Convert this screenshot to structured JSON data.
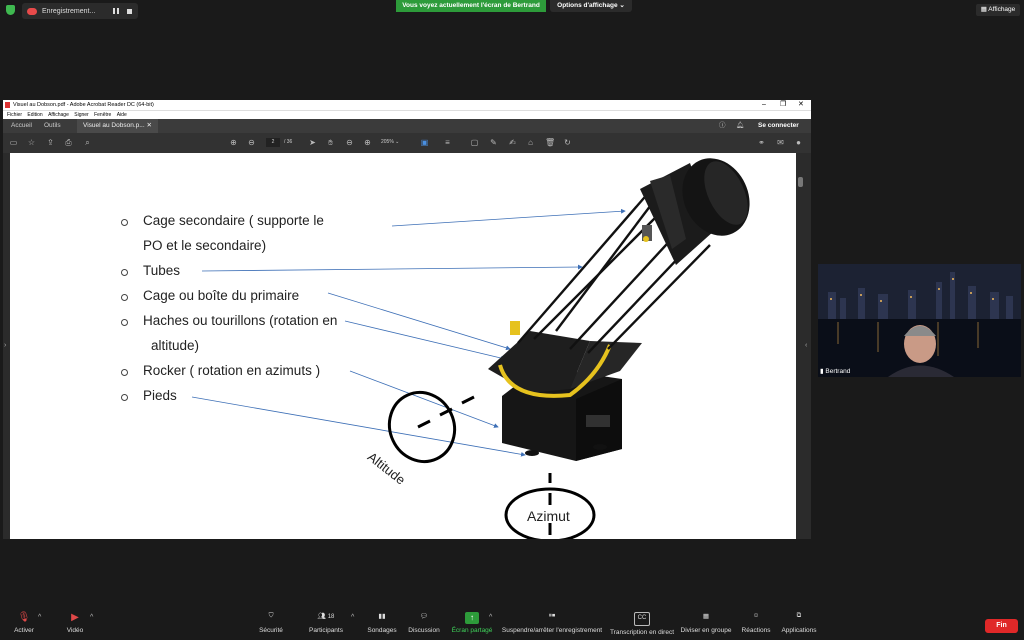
{
  "zoom": {
    "recording_label": "Enregistrement...",
    "share_banner": "Vous voyez actuellement l'écran de Bertrand",
    "view_options": "Options d'affichage",
    "affichage": "Affichage",
    "participant_name": "Bertrand",
    "participants_count": "18",
    "end_button": "Fin",
    "toolbar": [
      {
        "id": "activer",
        "label": "Activer"
      },
      {
        "id": "video",
        "label": "Vidéo"
      },
      {
        "id": "securite",
        "label": "Sécurité"
      },
      {
        "id": "participants",
        "label": "Participants"
      },
      {
        "id": "sondages",
        "label": "Sondages"
      },
      {
        "id": "discussion",
        "label": "Discussion"
      },
      {
        "id": "ecran",
        "label": "Écran partagé"
      },
      {
        "id": "suspendre",
        "label": "Suspendre/arrêter l'enregistrement"
      },
      {
        "id": "transcription",
        "label": "Transcription en direct"
      },
      {
        "id": "diviser",
        "label": "Diviser en groupe"
      },
      {
        "id": "reactions",
        "label": "Réactions"
      },
      {
        "id": "applications",
        "label": "Applications"
      }
    ]
  },
  "acrobat": {
    "window_title": "Visuel au Dobson.pdf - Adobe Acrobat Reader DC (64-bit)",
    "menu": [
      "Fichier",
      "Edition",
      "Affichage",
      "Signer",
      "Fenêtre",
      "Aide"
    ],
    "tabs": {
      "home": "Accueil",
      "tools": "Outils",
      "doc": "Visuel au Dobson.p..."
    },
    "sign_in": "Se connecter",
    "page_current": "2",
    "page_total": "/ 36",
    "zoom": "205%"
  },
  "document": {
    "bullets": [
      {
        "id": "b1",
        "line1": "Cage secondaire ( supporte le",
        "line2": "PO  et le secondaire)"
      },
      {
        "id": "b2",
        "line1": "Tubes"
      },
      {
        "id": "b3",
        "line1": "Cage ou boîte du primaire"
      },
      {
        "id": "b4",
        "line1": "Haches ou tourillons (rotation en",
        "line2": "altitude)"
      },
      {
        "id": "b5",
        "line1": "Rocker ( rotation en azimuts )"
      },
      {
        "id": "b6",
        "line1": "Pieds"
      }
    ],
    "altitude_label": "Altitude",
    "azimut_label": "Azimut",
    "colors": {
      "arrow": "#3d6fb6",
      "brass": "#e6c21e",
      "body": "#1a1a1a"
    }
  }
}
